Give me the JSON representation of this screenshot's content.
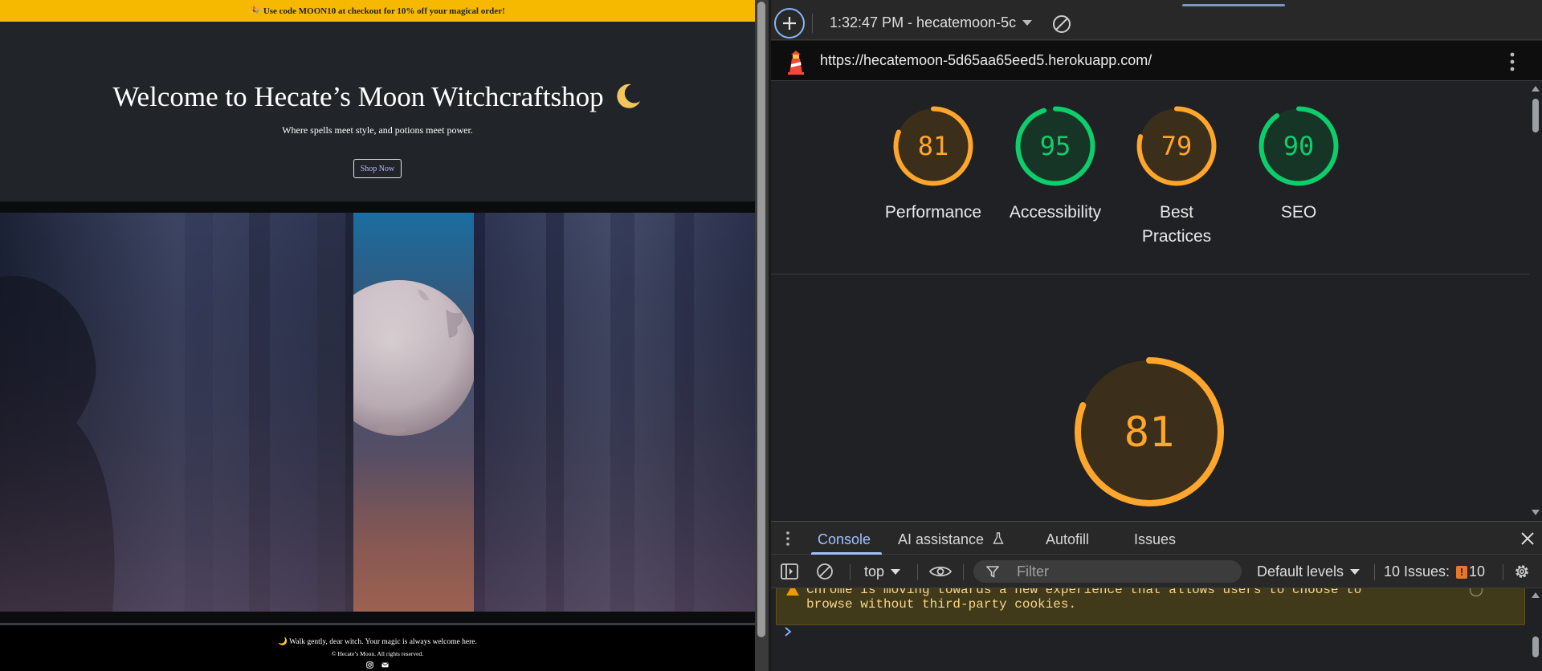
{
  "site": {
    "promo": {
      "emoji": "🎉",
      "text": "Use code MOON10 at checkout for 10% off your magical order!"
    },
    "hero": {
      "title": "Welcome to Hecate’s Moon Witchcraftshop",
      "subtitle": "Where spells meet style, and potions meet power.",
      "cta": "Shop Now"
    },
    "footer": {
      "tagline": "🌙 Walk gently, dear witch. Your magic is always welcome here.",
      "copyright": "© Hecate’s Moon. All rights reserved.",
      "icons": [
        "instagram-icon",
        "email-icon"
      ]
    }
  },
  "devtools": {
    "toolbar": {
      "report_label": "1:32:47 PM - hecatemoon-5c"
    },
    "url": "https://hecatemoon-5d65aa65eed5.herokuapp.com/",
    "scores": [
      {
        "name": "Performance",
        "score": 81,
        "level": "average"
      },
      {
        "name": "Accessibility",
        "score": 95,
        "level": "pass"
      },
      {
        "name": "Best Practices",
        "score": 79,
        "level": "average"
      },
      {
        "name": "SEO",
        "score": 90,
        "level": "pass"
      }
    ],
    "big_score": {
      "score": 81,
      "level": "average"
    },
    "drawer_tabs": [
      "Console",
      "AI assistance",
      "Autofill",
      "Issues"
    ],
    "console_toolbar": {
      "context": "top",
      "filter_placeholder": "Filter",
      "levels": "Default levels",
      "issues_label": "10 Issues:",
      "issues_count": "10"
    },
    "console_message": {
      "line1": "Chrome is moving towards a new experience that allows users to choose to",
      "line2": "browse without third-party cookies."
    },
    "colors": {
      "average": "#ffa62b",
      "pass": "#0cce6b",
      "accent": "#8ab4f8",
      "promo": "#f6b900"
    }
  }
}
